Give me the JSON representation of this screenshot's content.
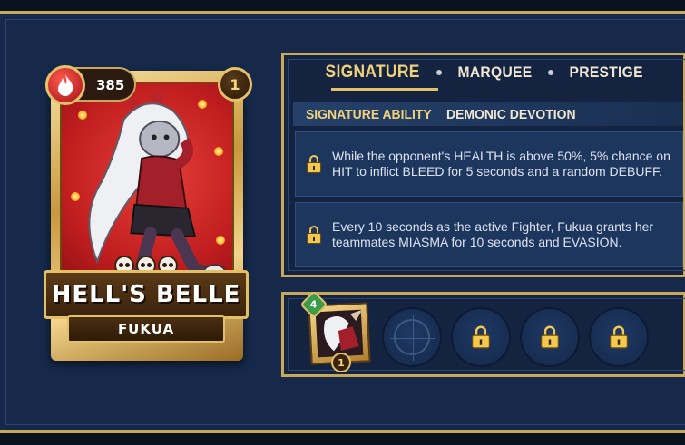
{
  "card": {
    "cost": "385",
    "level": "1",
    "title": "HELL'S BELLE",
    "subtitle": "FUKUA",
    "skull_count": 3
  },
  "tabs": [
    {
      "label": "SIGNATURE",
      "active": true
    },
    {
      "label": "MARQUEE",
      "active": false
    },
    {
      "label": "PRESTIGE",
      "active": false
    }
  ],
  "ability": {
    "kind": "SIGNATURE ABILITY",
    "name": "DEMONIC DEVOTION",
    "effects": [
      "While the opponent's HEALTH is above 50%, 5% chance on HIT to inflict BLEED for 5 seconds and a random DEBUFF.",
      "Every 10 seconds as the active Fighter, Fukua grants her teammates MIASMA for 10 seconds and EVASION."
    ]
  },
  "slots": {
    "equipped": {
      "gem_level": "4",
      "level": "1"
    },
    "empty_icon": "crosshair-icon",
    "locked_icon": "lock-icon"
  },
  "colors": {
    "gold": "#c9a85a",
    "panel": "#132340",
    "active_tab": "#f1d27a",
    "card_red": "#c01d1f"
  }
}
